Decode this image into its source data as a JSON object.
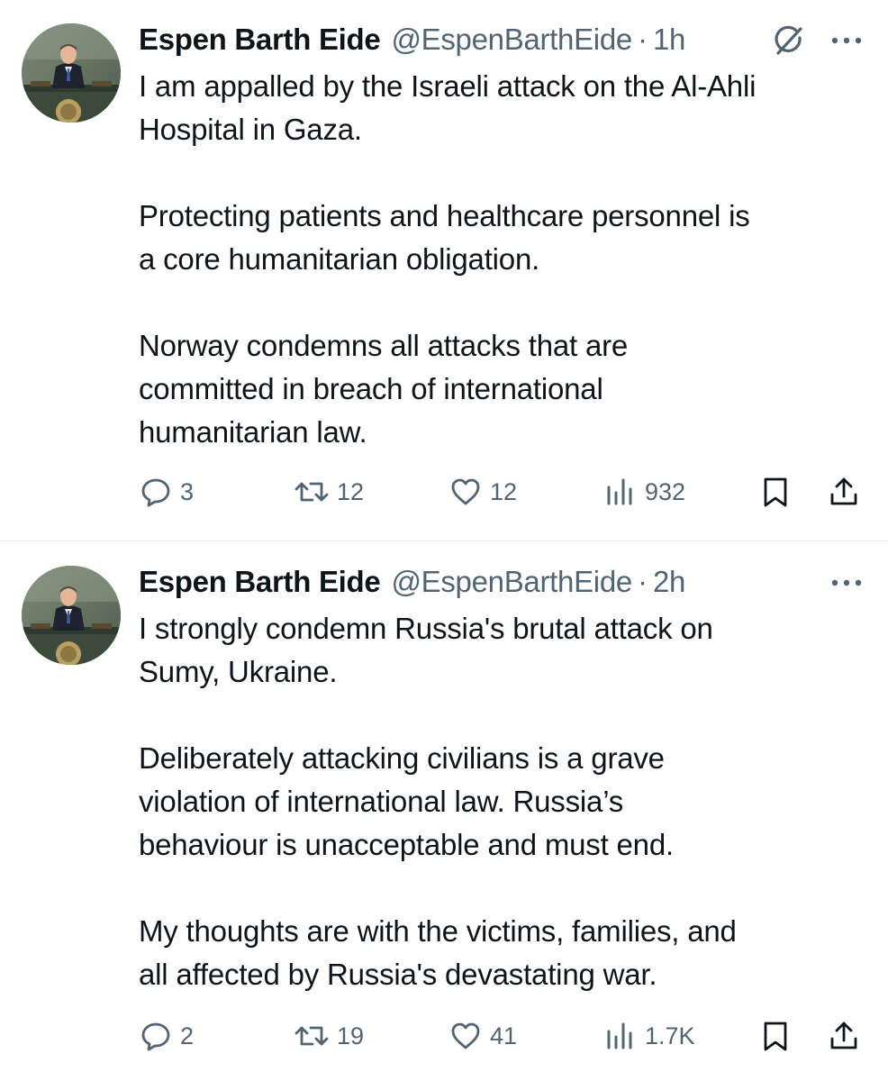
{
  "tweets": [
    {
      "author": {
        "name": "Espen Barth Eide",
        "handle": "@EspenBarthEide",
        "avatar_icon": "avatar-photo"
      },
      "separator": "·",
      "time": "1h",
      "show_grok_icon": true,
      "paragraphs": [
        "I am appalled by the Israeli attack on the Al-Ahli\nHospital in Gaza.",
        "Protecting patients and healthcare personnel is\na core humanitarian obligation.",
        "Norway condemns all attacks that are\ncommitted in breach of international\nhumanitarian law."
      ],
      "metrics": {
        "replies": "3",
        "retweets": "12",
        "likes": "12",
        "views": "932"
      }
    },
    {
      "author": {
        "name": "Espen Barth Eide",
        "handle": "@EspenBarthEide",
        "avatar_icon": "avatar-photo"
      },
      "separator": "·",
      "time": "2h",
      "show_grok_icon": false,
      "paragraphs": [
        "I strongly condemn Russia's brutal attack on\nSumy, Ukraine.",
        "Deliberately attacking civilians is a grave\nviolation of international law. Russia’s\nbehaviour is unacceptable and must end.",
        "My thoughts are with the victims, families, and\nall affected by Russia's devastating war."
      ],
      "metrics": {
        "replies": "2",
        "retweets": "19",
        "likes": "41",
        "views": "1.7K"
      }
    }
  ],
  "icons": {
    "reply": "reply-icon",
    "retweet": "retweet-icon",
    "like": "heart-icon",
    "views": "views-icon",
    "bookmark": "bookmark-icon",
    "share": "share-icon",
    "more": "more-icon",
    "grok": "grok-icon"
  },
  "colors": {
    "text_primary": "#0f1419",
    "text_secondary": "#536471",
    "divider": "#e1e8ed"
  }
}
